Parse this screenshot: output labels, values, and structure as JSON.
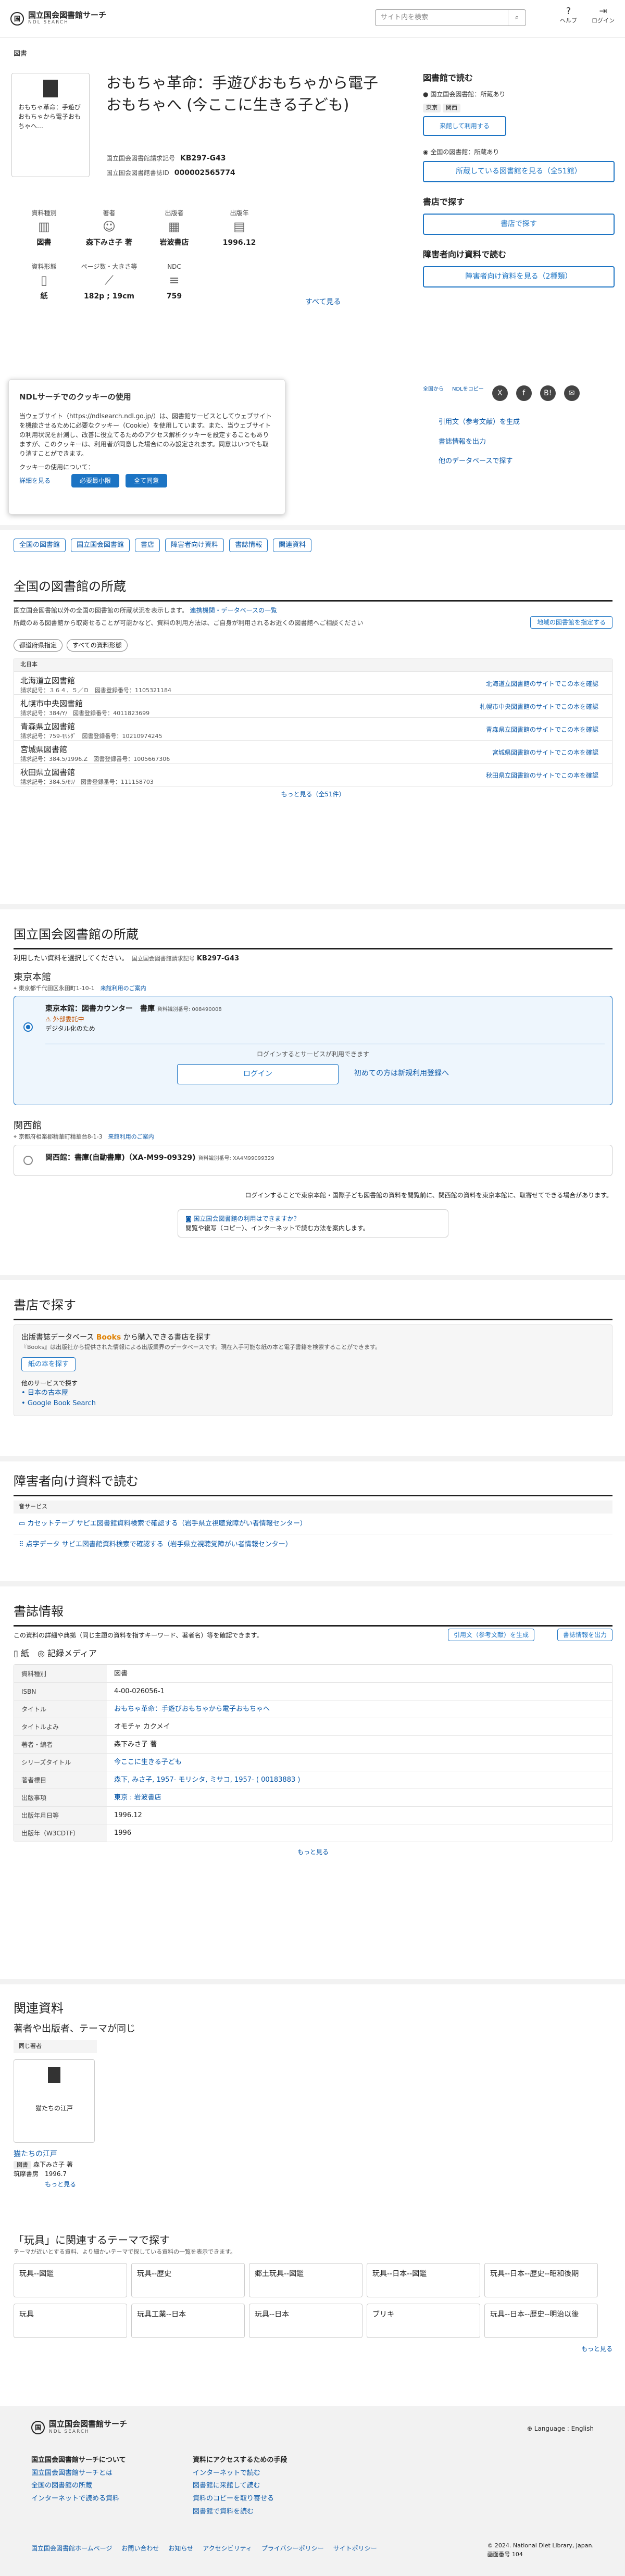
{
  "header": {
    "logo_ja": "国立国会図書館サーチ",
    "logo_en": "NDL SEARCH",
    "search_placeholder": "サイト内を検索",
    "icons": [
      {
        "name": "help-icon",
        "label": "ヘルプ"
      },
      {
        "name": "login-icon",
        "label": "ログイン"
      }
    ]
  },
  "breadcrumb": "図書",
  "book": {
    "thumb_text": "おもちゃ革命：手遊びおもちゃから電子おもちゃへ…",
    "title": "おもちゃ革命：手遊びおもちゃから電子おもちゃへ (今ここに生きる子ども)",
    "callno_label": "国立国会図書館請求記号",
    "callno": "KB297-G43",
    "pid_label": "国立国会図書館書誌ID",
    "pid": "000002565774"
  },
  "meta": [
    [
      {
        "icon": "book-icon",
        "label": "資料種別",
        "value": "図書"
      },
      {
        "icon": "person-icon",
        "label": "著者",
        "value": "森下みさ子 著"
      },
      {
        "icon": "building-icon",
        "label": "出版者",
        "value": "岩波書店"
      },
      {
        "icon": "calendar-icon",
        "label": "出版年",
        "value": "1996.12"
      }
    ],
    [
      {
        "icon": "paper-icon",
        "label": "資料形態",
        "value": "紙"
      },
      {
        "icon": "ruler-icon",
        "label": "ページ数・大きさ等",
        "value": "182p ; 19cm"
      },
      {
        "icon": "ndc-icon",
        "label": "NDC",
        "value": "759"
      }
    ]
  ],
  "see_all": "すべて見る",
  "right": {
    "read_h": "図書館で読む",
    "ndl_own": "国立国会図書館：所蔵あり",
    "tags": [
      "東京",
      "関西"
    ],
    "visit": "来館して利用する",
    "nat_own": "全国の図書館：所蔵あり",
    "nat_btn": "所蔵している図書館を見る（全51館）",
    "buy_h": "書店で探す",
    "buy_btn": "書店で探す",
    "acc_h": "障害者向け資料で読む",
    "acc_btn": "障害者向け資料を見る（2種類）",
    "share": [
      "全国から",
      "NDLをコピー",
      "X",
      "f",
      "B!",
      "✉"
    ],
    "links": [
      "引用文（参考文献）を生成",
      "書誌情報を出力",
      "他のデータベースで探す"
    ]
  },
  "cookie": {
    "title": "NDLサーチでのクッキーの使用",
    "body": "当ウェブサイト（https://ndlsearch.ndl.go.jp/）は、図書館サービスとしてウェブサイトを機能させるために必要なクッキー（Cookie）を使用しています。また、当ウェブサイトの利用状況を計測し、改善に役立てるためのアクセス解析クッキーを設定することもありますが、このクッキーは、利用者が同意した場合にのみ設定されます。同意はいつでも取り消すことができます。",
    "policy": "クッキーの使用について：",
    "detail": "詳細を見る",
    "b1": "必要最小限",
    "b2": "全て同意"
  },
  "tabs": [
    "全国の図書館",
    "国立国会図書館",
    "書店",
    "障害者向け資料",
    "書誌情報",
    "関連資料"
  ],
  "national": {
    "h": "全国の図書館の所蔵",
    "desc": "国立国会図書館以外の全国の図書館の所蔵状況を表示します。",
    "desc_link": "連携機関・データベースの一覧",
    "note": "所蔵のある図書館から取寄せることが可能かなど、資料の利用方法は、ご自身が利用されるお近くの図書館へご相談ください",
    "filter_btn": "地域の図書館を指定する",
    "f1": "都道府県指定",
    "f2": "すべての資料形態",
    "col": "北日本",
    "libs": [
      {
        "n": "北海道立図書館",
        "d": "請求記号：３６４．５／Ｄ　図書登録番号：1105321184",
        "r": "北海道立図書館のサイトでこの本を確認"
      },
      {
        "n": "札幌市中央図書館",
        "d": "請求記号：384/Y/　図書登録番号：4011823699",
        "r": "札幌市中央図書館のサイトでこの本を確認"
      },
      {
        "n": "青森県立図書館",
        "d": "請求記号：759-ﾓﾘｼﾀﾞ　図書登録番号：10210974245",
        "r": "青森県立図書館のサイトでこの本を確認"
      },
      {
        "n": "宮城県図書館",
        "d": "請求記号：384.5/1996.Z　図書登録番号：1005667306",
        "r": "宮城県図書館のサイトでこの本を確認"
      },
      {
        "n": "秋田県立図書館",
        "d": "請求記号：384.5/ﾓﾘ/　図書登録番号：111158703",
        "r": "秋田県立図書館のサイトでこの本を確認"
      }
    ],
    "more": "もっと見る（全51件）"
  },
  "ndl": {
    "h": "国立国会図書館の所蔵",
    "desc": "利用したい資料を選択してください。",
    "callno_label": "国立国会図書館請求記号",
    "callno": "KB297-G43",
    "tokyo": "東京本館",
    "tokyo_addr": "東京都千代田区永田町1-10-1",
    "tokyo_link": "来館利用のご案内",
    "t_item": "東京本館：図書カウンター　書庫",
    "t_id": "資料識別番号: 008490008",
    "t_status": "外部委託中",
    "t_sub": "デジタル化のため",
    "login_note": "ログインするとサービスが利用できます",
    "login_btn": "ログイン",
    "reg_btn": "初めての方は新規利用登録へ",
    "kansai": "関西館",
    "k_addr": "京都府相楽郡精華町精華台8-1-3",
    "k_link": "来館利用のご案内",
    "k_item": "関西館：書庫(自動書庫)（XA-M99-09329)",
    "k_id": "資料識別番号: XA4M99099329",
    "foot": "ログインすることで東京本館・国際子ども図書館の資料を閲覧前に、関西館の資料を東京本館に、取寄せてできる場合があります。",
    "help_h": "国立国会図書館の利用はできますか？",
    "help_b": "閲覧や複写（コピー）、インターネットで読む方法を案内します。"
  },
  "store": {
    "h": "書店で探す",
    "sub": "出版書誌データベース",
    "brand": "Books",
    "sub2": "から購入できる書店を探す",
    "note": "『Books』は出版社から提供された情報による出版業界のデータベースです。現在入手可能な紙の本と電子書籍を検索することができます。",
    "btn": "紙の本を探す",
    "other": "他のサービスで探す",
    "links": [
      "日本の古本屋",
      "Google Book Search"
    ]
  },
  "acc": {
    "h": "障害者向け資料で読む",
    "sub": "音サービス",
    "items": [
      "カセットテープ サピエ図書館資料検索で確認する（岩手県立視聴覚障がい者情報センター）",
      "点字データ サピエ図書館資料検索で確認する（岩手県立視聴覚障がい者情報センター）"
    ]
  },
  "bib": {
    "h": "書誌情報",
    "desc": "この資料の詳細や典拠（同じ主題の資料を指すキーワード、著者名）等を確認できます。",
    "b1": "引用文（参考文献）を生成",
    "b2": "書誌情報を出力",
    "media": "紙",
    "media2": "記録メディア",
    "rows": [
      [
        "資料種別",
        "図書"
      ],
      [
        "ISBN",
        "4-00-026056-1"
      ],
      [
        "タイトル",
        "おもちゃ革命：手遊びおもちゃから電子おもちゃへ"
      ],
      [
        "タイトルよみ",
        "オモチャ カクメイ"
      ],
      [
        "著者・編者",
        "森下みさ子 著"
      ],
      [
        "シリーズタイトル",
        "今ここに生きる子ども"
      ],
      [
        "著者標目",
        "森下, みさ子, 1957- モリシタ, ミサコ, 1957- ( 00183883 )"
      ],
      [
        "出版事項",
        "東京 : 岩波書店"
      ],
      [
        "出版年月日等",
        "1996.12"
      ],
      [
        "出版年（W3CDTF）",
        "1996"
      ]
    ],
    "more": "もっと見る"
  },
  "related": {
    "h": "関連資料",
    "sub": "著者や出版者、テーマが同じ",
    "tag": "同じ著者",
    "book_title": "猫たちの江戸",
    "cap": "猫たちの江戸",
    "kind": "図書",
    "author": "森下みさ子 著",
    "pub": "筑摩書房",
    "year": "1996.7",
    "more": "もっと見る"
  },
  "themes": {
    "h": "「玩具」に関連するテーマで探す",
    "desc": "テーマが近いとする資料、より細かいテーマで探している資料の一覧を表示できます。",
    "items": [
      "玩具--図鑑",
      "玩具--歴史",
      "郷土玩具--図鑑",
      "玩具--日本--図鑑",
      "玩具--日本--歴史--昭和後期",
      "玩具",
      "玩具工業--日本",
      "玩具--日本",
      "ブリキ",
      "玩具--日本--歴史--明治以後"
    ],
    "more": "もっと見る"
  },
  "footer": {
    "lang": "Language : English",
    "c1h": "国立国会図書館サーチについて",
    "c1": [
      "国立国会図書館サーチとは",
      "全国の図書館の所蔵",
      "インターネットで読める資料"
    ],
    "c2h": "資料にアクセスするための手段",
    "c2": [
      "インターネットで読む",
      "図書館に来館して読む",
      "資料のコピーを取り寄せる",
      "図書館で資料を読む"
    ],
    "bottom": [
      "国立国会図書館ホームページ",
      "お問い合わせ",
      "お知らせ",
      "アクセシビリティ",
      "プライバシーポリシー",
      "サイトポリシー"
    ],
    "copy": "© 2024. National Diet Library, Japan.",
    "ver_label": "画面番号",
    "ver": "104"
  }
}
